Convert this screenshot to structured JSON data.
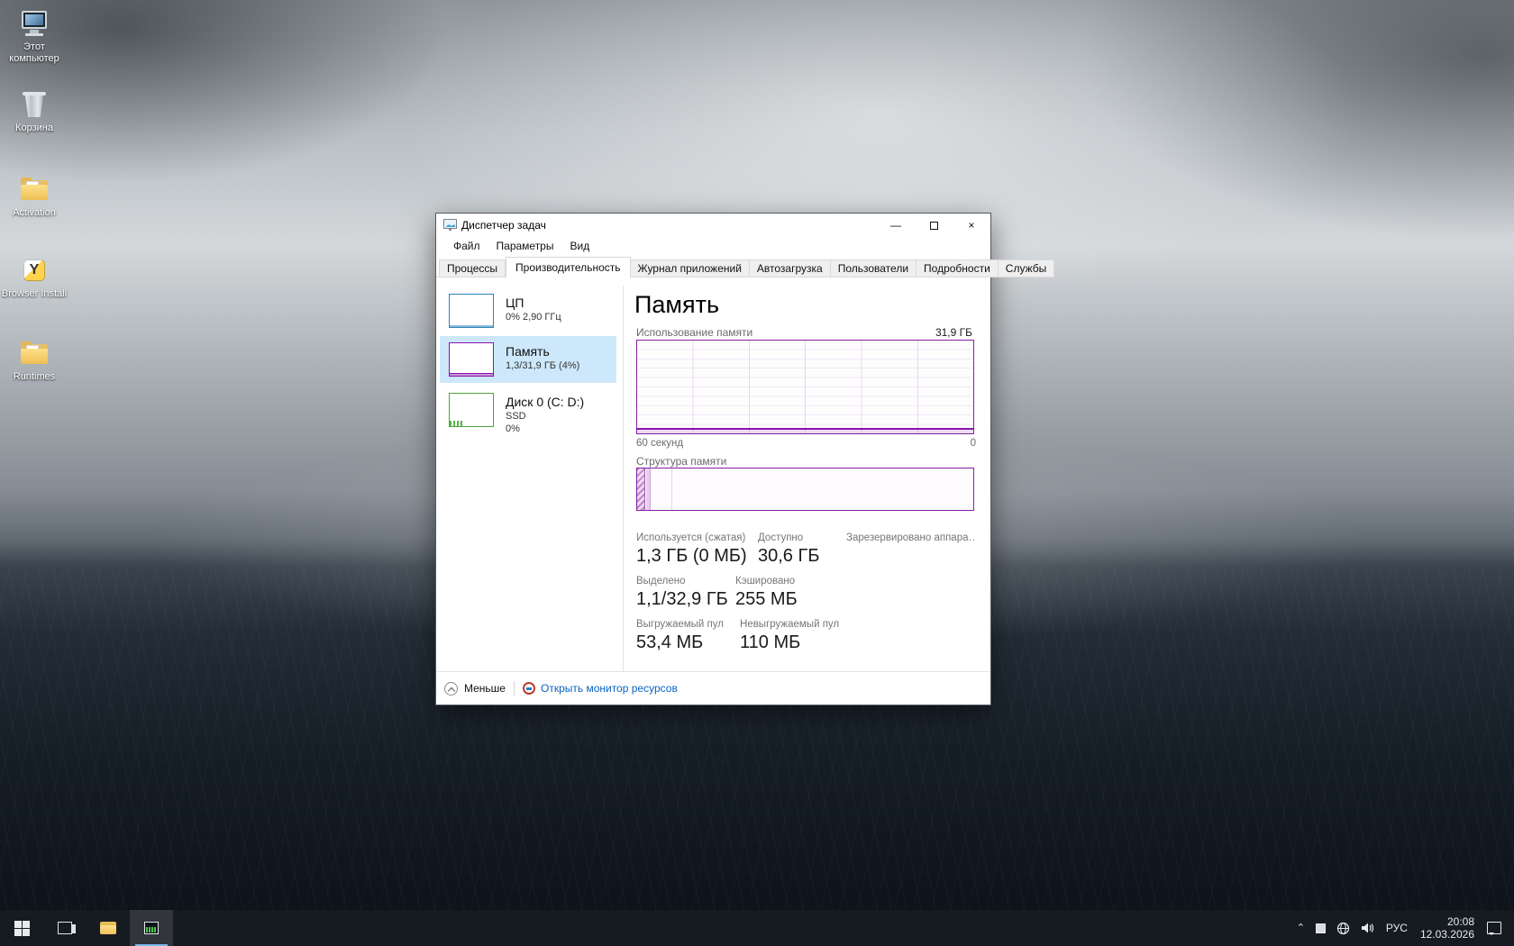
{
  "desktop": {
    "icons": [
      {
        "id": "this-pc",
        "label": "Этот компьютер"
      },
      {
        "id": "recycle-bin",
        "label": "Корзина"
      },
      {
        "id": "activation",
        "label": "Activation"
      },
      {
        "id": "browser-install",
        "label": "Browser Install"
      },
      {
        "id": "runtimes",
        "label": "Runtimes"
      }
    ]
  },
  "window": {
    "title": "Диспетчер задач",
    "controls": {
      "minimize": "—",
      "close": "×"
    },
    "menu": [
      {
        "label": "Файл"
      },
      {
        "label": "Параметры"
      },
      {
        "label": "Вид"
      }
    ],
    "tabs": [
      {
        "label": "Процессы"
      },
      {
        "label": "Производительность"
      },
      {
        "label": "Журнал приложений"
      },
      {
        "label": "Автозагрузка"
      },
      {
        "label": "Пользователи"
      },
      {
        "label": "Подробности"
      },
      {
        "label": "Службы"
      }
    ],
    "sidebar": [
      {
        "name": "ЦП",
        "detail": "0%  2,90 ГГц",
        "detail2": "",
        "color": "#2e83b8"
      },
      {
        "name": "Память",
        "detail": "1,3/31,9 ГБ (4%)",
        "detail2": "",
        "color": "#8b12ae"
      },
      {
        "name": "Диск 0 (C: D:)",
        "detail": "SSD",
        "detail2": "0%",
        "color": "#4da33e"
      }
    ],
    "main": {
      "title": "Память",
      "usage_graph": {
        "label": "Использование памяти",
        "total": "31,9 ГБ",
        "x_left": "60 секунд",
        "x_right": "0",
        "accent": "#8b12ae",
        "current_percent": 4
      },
      "composition": {
        "label": "Структура памяти"
      },
      "stats": {
        "used_label": "Используется (сжатая)",
        "used_value": "1,3 ГБ (0 МБ)",
        "avail_label": "Доступно",
        "avail_value": "30,6 ГБ",
        "reserved_label": "Зарезервировано аппара…",
        "committed_label": "Выделено",
        "committed_value": "1,1/32,9 ГБ",
        "cached_label": "Кэшировано",
        "cached_value": "255 МБ",
        "paged_label": "Выгружаемый пул",
        "paged_value": "53,4 МБ",
        "nonpaged_label": "Невыгружаемый пул",
        "nonpaged_value": "110 МБ"
      },
      "footer": {
        "less": "Меньше",
        "open_resmon": "Открыть монитор ресурсов"
      }
    }
  },
  "taskbar": {
    "language": "РУС",
    "time": "20:08",
    "date": "12.03.2026"
  }
}
